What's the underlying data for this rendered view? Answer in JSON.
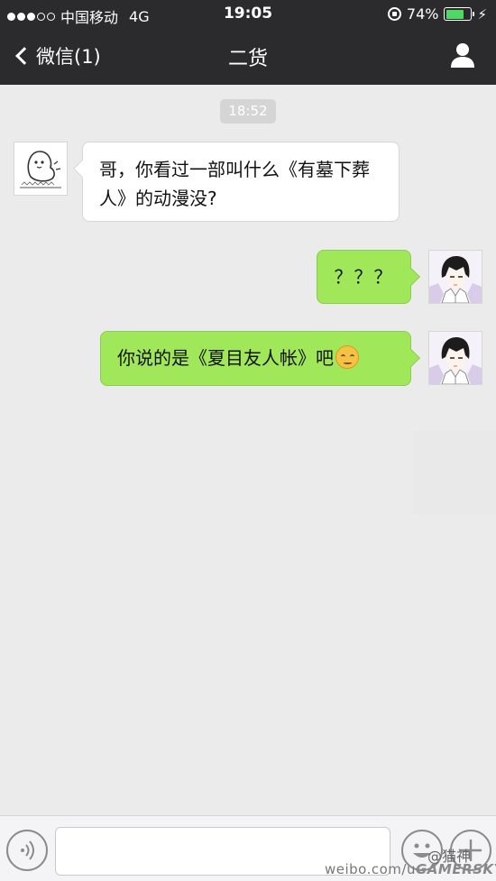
{
  "status_bar": {
    "carrier": "中国移动",
    "network": "4G",
    "time": "19:05",
    "battery_percent": "74%",
    "battery_level": 0.74,
    "signal_bars_filled": 3,
    "signal_bars_total": 5
  },
  "nav": {
    "back_label": "微信(1)",
    "title": "二货"
  },
  "chat": {
    "timestamp": "18:52",
    "messages": [
      {
        "side": "incoming",
        "text": "哥，你看过一部叫什么《有墓下葬人》的动漫没?"
      },
      {
        "side": "outgoing",
        "text": "？？？"
      },
      {
        "side": "outgoing",
        "text": "你说的是《夏目友人帐》吧",
        "emoji": "relieved-face-icon"
      }
    ]
  },
  "colors": {
    "header_bg": "#2b2b2d",
    "chat_bg": "#ebebeb",
    "outgoing_bubble": "#a0e75a",
    "incoming_bubble": "#ffffff"
  },
  "watermark": {
    "url": "weibo.com/u",
    "overlay": "GAMERSKY",
    "handle": "@猫神"
  }
}
